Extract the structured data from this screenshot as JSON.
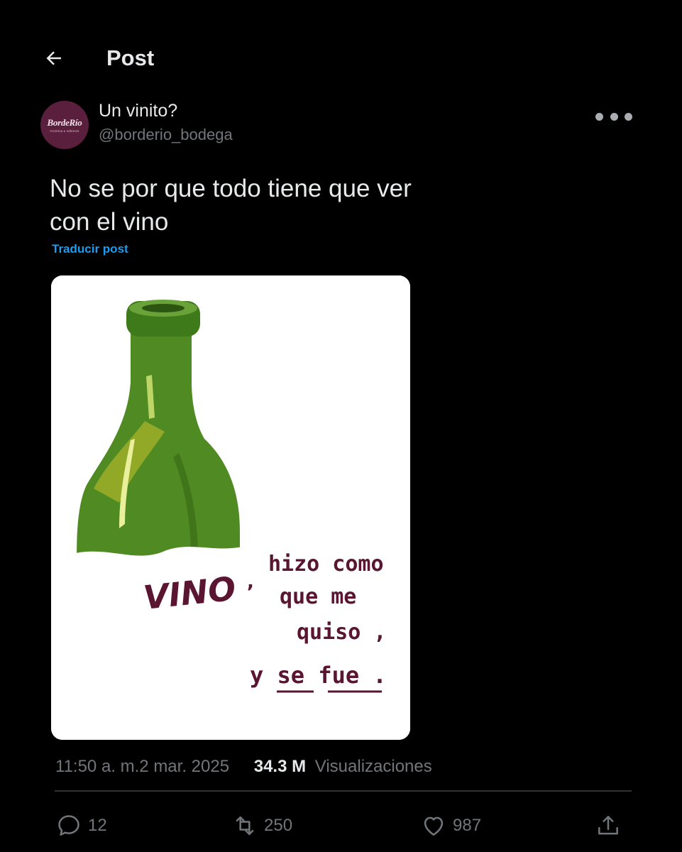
{
  "header": {
    "title": "Post",
    "back_icon": "arrow-left-icon"
  },
  "author": {
    "display_name": "Un vinito?",
    "handle": "@borderio_bodega",
    "avatar": {
      "logo_text": "BordeRío",
      "sub_text": "PIZZERIA & VIÑEDOS",
      "color": "#5b1f3e"
    }
  },
  "post": {
    "text": "No se por que todo tiene que ver con el vino",
    "translate_label": "Traducir post",
    "image": {
      "bottle_label": "VINO",
      "lines": [
        "hizo como",
        "que me",
        "quiso ,",
        "y se fue ."
      ],
      "ink_color": "#5a1530",
      "bottle_color": "#4f8a22"
    },
    "time": "11:50 a. m.",
    "date": "2 mar. 2025",
    "views_count": "34.3 M",
    "views_label": "Visualizaciones"
  },
  "actions": {
    "reply": {
      "icon": "reply-bubble-icon",
      "count": "12"
    },
    "retweet": {
      "icon": "retweet-icon",
      "count": "250"
    },
    "like": {
      "icon": "heart-icon",
      "count": "987"
    },
    "share": {
      "icon": "share-icon"
    }
  },
  "colors": {
    "accent": "#1d9bf0",
    "muted": "#71767b",
    "text": "#e7e9ea",
    "background": "#000000"
  }
}
